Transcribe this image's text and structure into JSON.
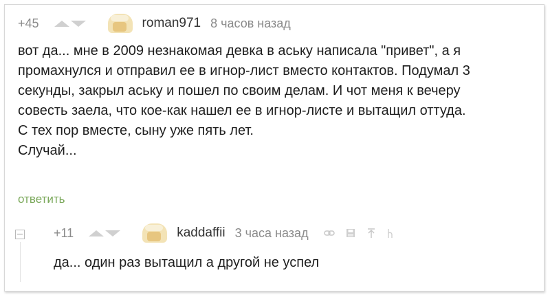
{
  "comment1": {
    "rating": "+45",
    "author": "roman971",
    "time": "8 часов назад",
    "text_lines": [
      "вот да... мне в 2009 незнакомая девка в аську написала \"привет\", а я",
      "промахнулся и отправил ее в игнор-лист вместо контактов. Подумал 3",
      "секунды, закрыл аську и пошел по своим делам. И чот меня к вечеру",
      "совесть заела, что кое-как нашел ее в игнор-листе и вытащил оттуда.",
      "С тех пор вместе, сыну уже пять лет.",
      "Случай..."
    ],
    "reply_label": "ответить"
  },
  "comment2": {
    "rating": "+11",
    "author": "kaddaffii",
    "time": "3 часа назад",
    "text": "да... один раз вытащил а другой не успел"
  },
  "icons": {
    "vote_up": "arrow-up-icon",
    "vote_down": "arrow-down-icon",
    "collapse": "collapse-icon",
    "link": "link-icon",
    "save": "save-icon",
    "to_top": "arrow-up-bar-icon",
    "cursor": "cursor-icon"
  },
  "colors": {
    "rating": "#8a8a8a",
    "reply_link": "#7aa85a",
    "arrows": "#d0d0d0"
  }
}
